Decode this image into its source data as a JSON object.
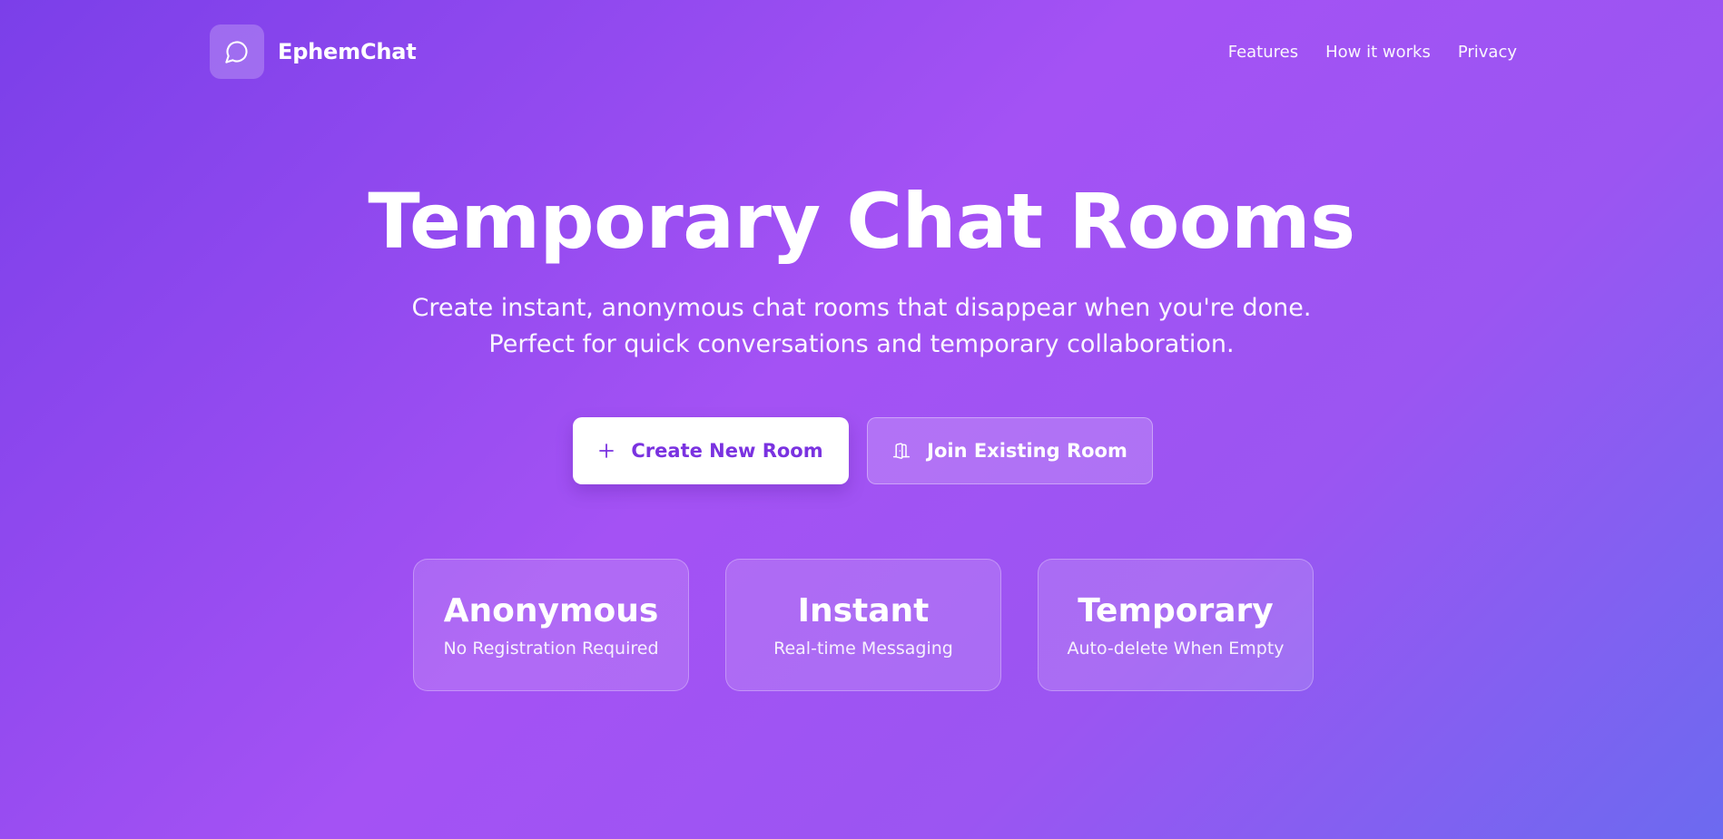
{
  "brand": {
    "name": "EphemChat",
    "logo_icon": "chat-bubble-icon"
  },
  "nav": {
    "items": [
      {
        "label": "Features"
      },
      {
        "label": "How it works"
      },
      {
        "label": "Privacy"
      }
    ]
  },
  "hero": {
    "title": "Temporary Chat Rooms",
    "subtitle": "Create instant, anonymous chat rooms that disappear when you're done. Perfect for quick conversations and temporary collaboration."
  },
  "actions": {
    "create": {
      "label": "Create New Room",
      "icon": "plus-icon"
    },
    "join": {
      "label": "Join Existing Room",
      "icon": "door-open-icon"
    }
  },
  "features": [
    {
      "title": "Anonymous",
      "subtitle": "No Registration Required"
    },
    {
      "title": "Instant",
      "subtitle": "Real-time Messaging"
    },
    {
      "title": "Temporary",
      "subtitle": "Auto-delete When Empty"
    }
  ],
  "colors": {
    "gradient_start": "#7b3fe9",
    "gradient_mid": "#a452f4",
    "gradient_end": "#6c6af0",
    "primary_button_text": "#7a32e0"
  }
}
